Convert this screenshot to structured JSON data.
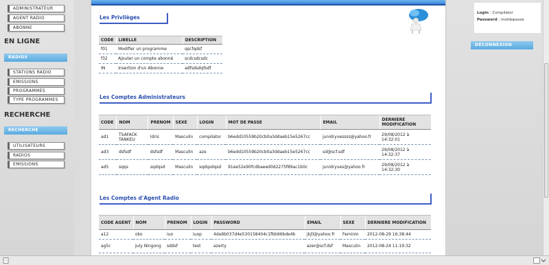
{
  "sidebar": {
    "top_items": [
      "ADMINISTRATEUR",
      "AGENT RADIO",
      "ABONNE"
    ],
    "en_ligne_title": "EN LIGNE",
    "radios_button": "RADIOS",
    "radio_items": [
      "STATIONS RADIO",
      "EMISSIONS",
      "PROGRAMMES",
      "TYPE PROGRAMMES"
    ],
    "recherche_title": "RECHERCHE",
    "recherche_button": "RECHERCHE",
    "recherche_items": [
      "UTILISATEURS",
      "RADIOS",
      "EMISSIONS"
    ]
  },
  "privileges": {
    "title": "Les Privilèges",
    "headers": [
      "CODE",
      "LIBELLE",
      "DESCRIPTION"
    ],
    "rows": [
      [
        "f01",
        "Modifier un programme",
        "qscfqdsf"
      ],
      [
        "f32",
        "Ajouter un compte abonné",
        "scdcsdcsdc"
      ],
      [
        "IN",
        "Insertion d'un Abonne",
        "adfsdsdqfsdf"
      ]
    ]
  },
  "admins": {
    "title": "Les Comptes Administrateurs",
    "headers": [
      "CODE",
      "NOM",
      "PRENOM",
      "SEXE",
      "LOGIN",
      "MOT DE PASSE",
      "EMAIL",
      "DERNIERE MODIFICATION"
    ],
    "rows": [
      [
        "ad1",
        "TSAFACK TANKEU",
        "Idris",
        "Masculin",
        "compilator",
        "b6edd10559b20cb0a3ddaeb15e5267cc",
        "junidryvessss@yahoo.fr",
        "29/08/2012 à 14:32:01"
      ],
      [
        "ad3",
        "dsfsdf",
        "dsfsdf",
        "Masculin",
        "aze",
        "b6edd10559b20cb0a3ddaeb15e5267cc",
        "sd@scf.sdf",
        "29/08/2012 à 14:32:37"
      ],
      [
        "ad5",
        "sqqs",
        "sqdqsd",
        "Masculin",
        "sqdqsdqsd",
        "91ee52e90fcdbaeed0d2275f89ac1b0c",
        "junidryves@yahoo.fr",
        "29/08/2012 à 14:32:30"
      ]
    ]
  },
  "agents": {
    "title": "Les Comptes d'Agent Radio",
    "headers": [
      "CODE AGENT",
      "NOM",
      "PRENOM",
      "LOGIN",
      "PASSWORD",
      "EMAIL",
      "SEXE",
      "DERNIERE MODIFICATION"
    ],
    "rows": [
      [
        "a12",
        "oko",
        "iuo",
        "iuop",
        "4da9b037d4e530158404c1fbb96bde4b",
        "jkjll@yahoo.fr",
        "Feminin",
        "2012-08-29 16:38:44"
      ],
      [
        "ag5c",
        "July Ningong",
        "sddsf",
        "test",
        "azerty",
        "azer@scf.dsf",
        "Masculin",
        "2012-08-24 11:19:32"
      ]
    ]
  },
  "user_panel": {
    "login_label": "Login",
    "login_value": "Compilator",
    "password_label": "Password",
    "password_value": "motdepasse",
    "logout_button": "DÉCONNEXION"
  }
}
